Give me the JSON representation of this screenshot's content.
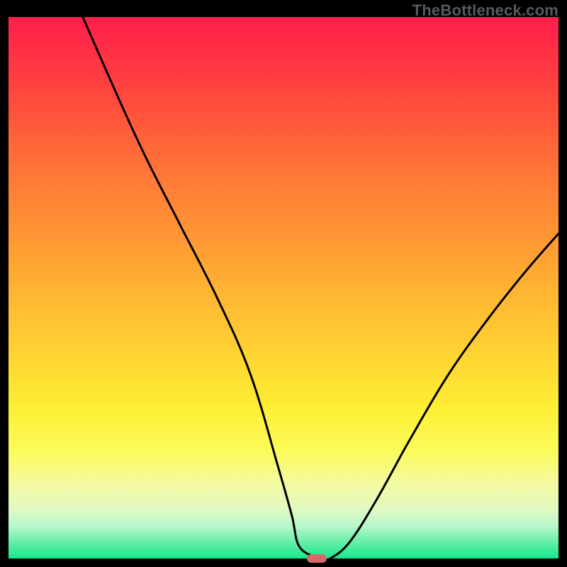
{
  "watermark": "TheBottleneck.com",
  "colors": {
    "gradient_top": "#ff1e4a",
    "gradient_bottom": "#17e78d",
    "curve_stroke": "#000000",
    "marker_fill": "#d66a6a",
    "frame": "#000000"
  },
  "chart_data": {
    "type": "line",
    "title": "",
    "xlabel": "",
    "ylabel": "",
    "xlim": [
      0,
      100
    ],
    "ylim": [
      0,
      100
    ],
    "grid": false,
    "legend": false,
    "series": [
      {
        "name": "curve",
        "x": [
          13.5,
          20,
          25,
          31,
          38,
          44,
          49,
          51.5,
          53,
          57,
          58.5,
          62,
          67,
          73,
          80,
          87,
          94,
          100
        ],
        "y": [
          100,
          85,
          74,
          62,
          48,
          34,
          17,
          8,
          2,
          0,
          0,
          3,
          11,
          22,
          34,
          44,
          53,
          60
        ]
      }
    ],
    "marker": {
      "x": 56,
      "y": 0
    },
    "background_heatmap": {
      "direction": "vertical",
      "stops": [
        {
          "pos": 0.0,
          "color": "#ff1e4a"
        },
        {
          "pos": 0.1,
          "color": "#ff3a42"
        },
        {
          "pos": 0.2,
          "color": "#ff5a3a"
        },
        {
          "pos": 0.3,
          "color": "#ff7a37"
        },
        {
          "pos": 0.4,
          "color": "#ff9533"
        },
        {
          "pos": 0.5,
          "color": "#ffb233"
        },
        {
          "pos": 0.62,
          "color": "#ffd333"
        },
        {
          "pos": 0.72,
          "color": "#feee34"
        },
        {
          "pos": 0.8,
          "color": "#fbfb58"
        },
        {
          "pos": 0.86,
          "color": "#f5faa0"
        },
        {
          "pos": 0.91,
          "color": "#e0f9c3"
        },
        {
          "pos": 0.94,
          "color": "#b7f7cb"
        },
        {
          "pos": 0.97,
          "color": "#65eea7"
        },
        {
          "pos": 1.0,
          "color": "#17e78d"
        }
      ]
    }
  }
}
